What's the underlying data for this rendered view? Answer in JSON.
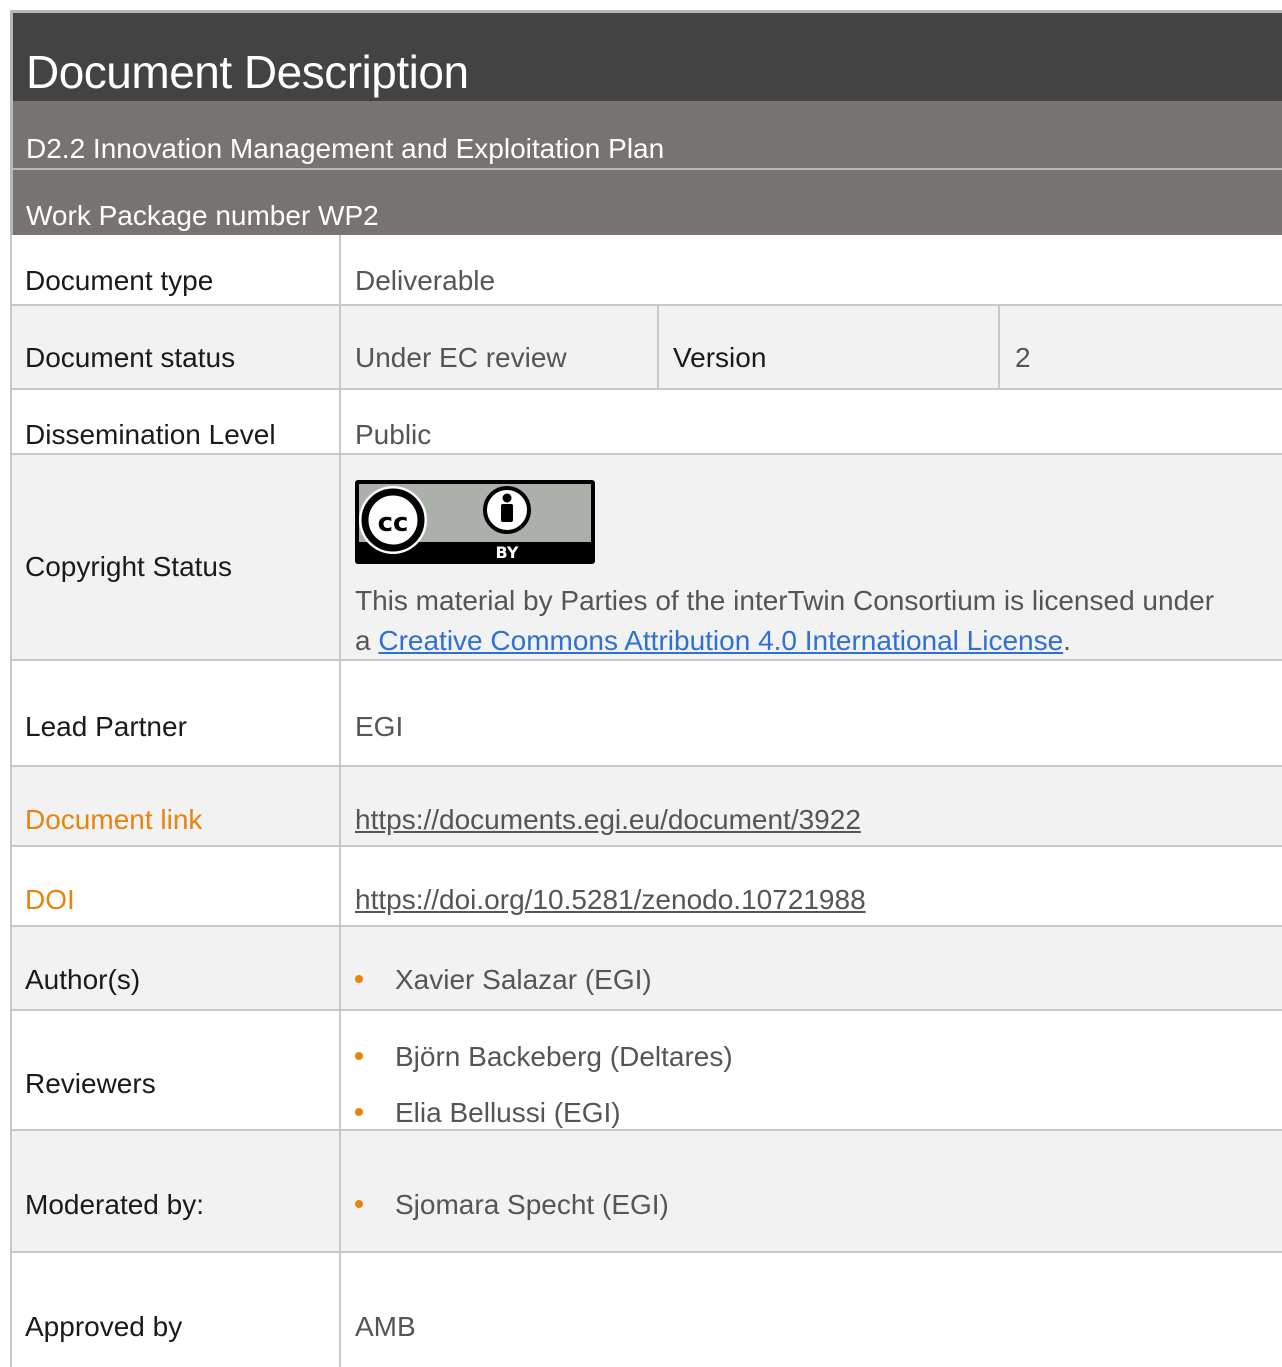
{
  "header": {
    "title": "Document Description",
    "deliverable": "D2.2 Innovation Management and Exploitation Plan",
    "work_package": "Work Package number WP2"
  },
  "rows": {
    "doc_type": {
      "label": "Document type",
      "value": "Deliverable"
    },
    "doc_status": {
      "label": "Document status",
      "value": "Under EC review",
      "version_label": "Version",
      "version_value": "2"
    },
    "dissemination": {
      "label": "Dissemination Level",
      "value": "Public"
    },
    "copyright": {
      "label": "Copyright Status",
      "badge_text": "BY",
      "text_before": "This material by Parties of the interTwin Consortium is licensed under",
      "text_a": "a ",
      "link_text": "Creative Commons Attribution 4.0 International License",
      "text_after": "."
    },
    "lead_partner": {
      "label": "Lead Partner",
      "value": "EGI"
    },
    "doc_link": {
      "label": "Document link",
      "value": "https://documents.egi.eu/document/3922"
    },
    "doi": {
      "label": "DOI",
      "value": "https://doi.org/10.5281/zenodo.10721988"
    },
    "authors": {
      "label": "Author(s)",
      "items": [
        "Xavier Salazar (EGI)"
      ]
    },
    "reviewers": {
      "label": "Reviewers",
      "items": [
        "Björn Backeberg (Deltares)",
        "Elia Bellussi (EGI)"
      ]
    },
    "moderated": {
      "label": "Moderated by:",
      "items": [
        "Sjomara Specht (EGI)"
      ]
    },
    "approved": {
      "label": "Approved by",
      "value": "AMB"
    }
  },
  "colors": {
    "accent": "#e8830c",
    "link": "#2f6fd6",
    "title_bg": "#434343",
    "sub_bg": "#777370",
    "row_bg": "#f2f2f2"
  }
}
